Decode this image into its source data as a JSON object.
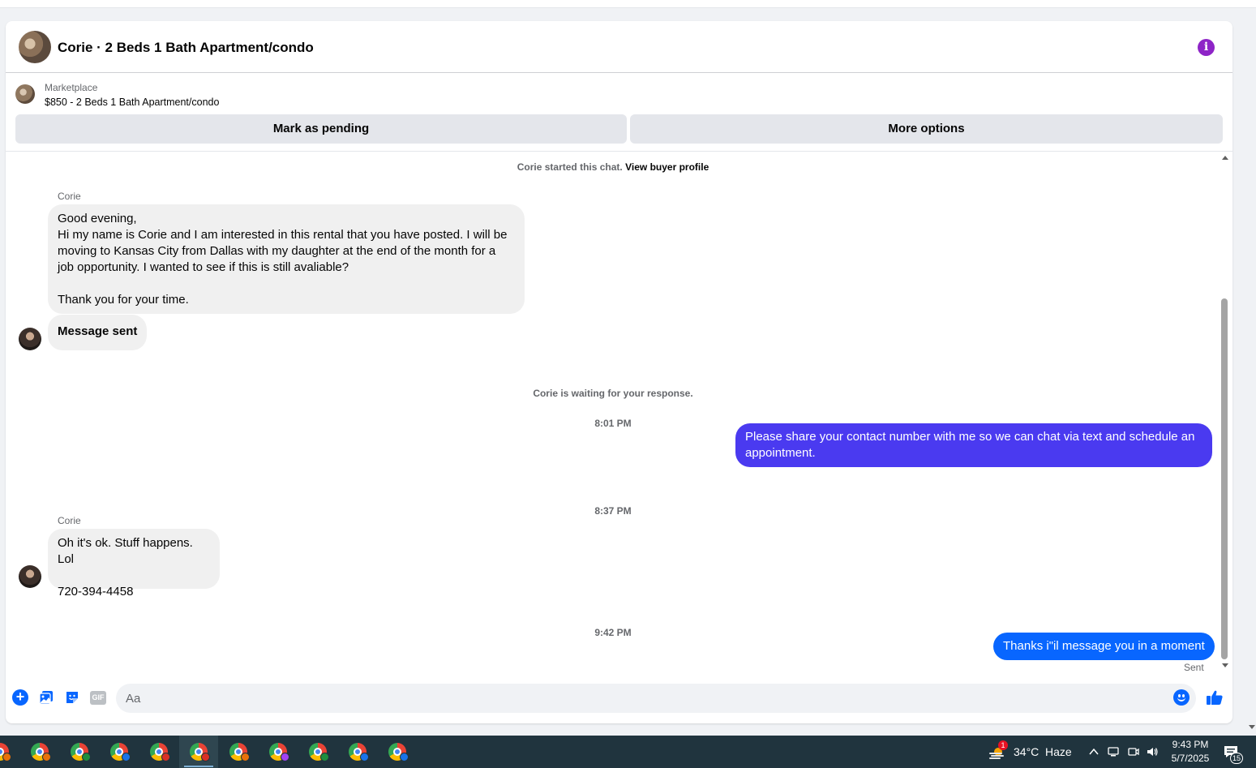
{
  "header": {
    "title": "Corie · 2 Beds 1 Bath Apartment/condo"
  },
  "marketplace": {
    "label": "Marketplace",
    "listing": "$850 - 2 Beds 1 Bath Apartment/condo",
    "mark_pending_label": "Mark as pending",
    "more_options_label": "More options"
  },
  "thread": {
    "started_text": "Corie started this chat.",
    "view_profile_label": "View buyer profile",
    "messages": [
      {
        "sender": "Corie",
        "text": "Good evening,\nHi my name is Corie and I am interested in this rental that you have posted. I will be\nmoving to Kansas City from Dallas with my daughter at the end of the month for a\njob opportunity. I wanted to see if this is still avaliable?\n\nThank you for your time."
      },
      {
        "text": "Message sent"
      },
      {
        "text": "Please share your contact number with me so we can chat via text and schedule an\nappointment."
      },
      {
        "sender": "Corie",
        "text": "Oh it's ok. Stuff happens. Lol\n\n720-394-4458"
      },
      {
        "text": "Thanks i\"il message you in a moment"
      }
    ],
    "waiting_text": "Corie is waiting for your response.",
    "times": [
      "8:01 PM",
      "8:37 PM",
      "9:42 PM"
    ],
    "sent_status": "Sent"
  },
  "composer": {
    "placeholder": "Aa",
    "gif_label": "GIF"
  },
  "colors": {
    "outgoing_purple": "#4a3af0",
    "outgoing_blue": "#0866ff",
    "info_icon": "#8e24c7",
    "incoming_bubble": "#f0f0f0"
  },
  "taskbar": {
    "weather_badge": "1",
    "temperature": "34°C",
    "weather": "Haze",
    "time": "9:43 PM",
    "date": "5/7/2025",
    "notification_count": "15",
    "profile_dot_colors": [
      "#e8710a",
      "#e8710a",
      "#1e8e3e",
      "#1a73e8",
      "#d93025",
      "#d93025",
      "#e8710a",
      "#a142f4",
      "#1e8e3e",
      "#1a73e8",
      "#1a73e8"
    ]
  }
}
